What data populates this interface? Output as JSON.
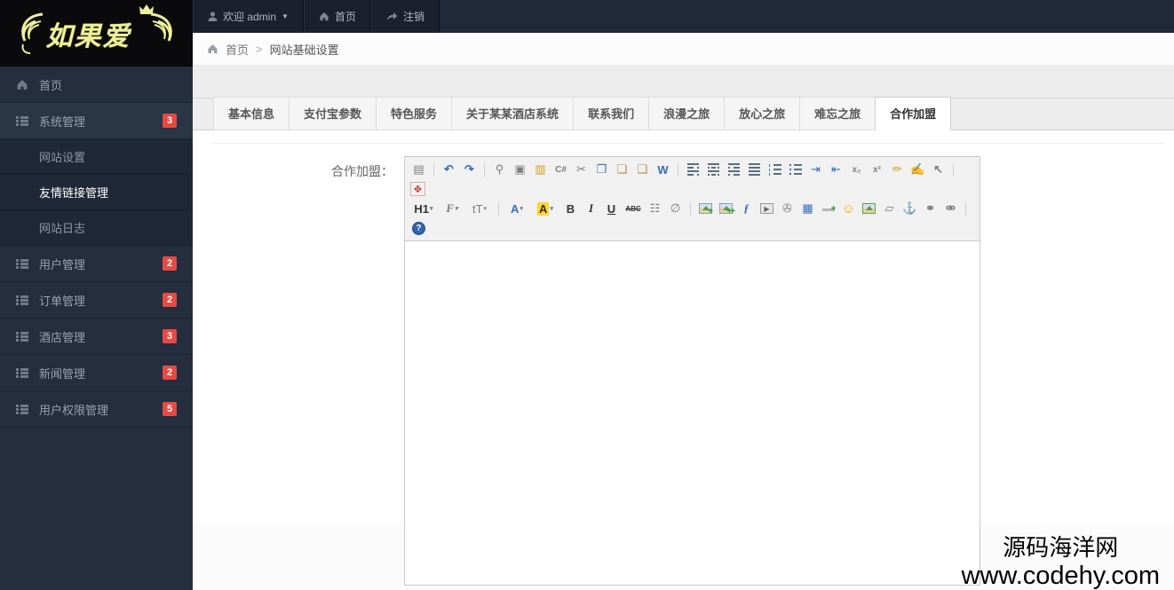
{
  "brand": {
    "name": "如果爱",
    "crown_icon": "crown",
    "wings_icon": "wings",
    "logo_color": "#eff09c"
  },
  "topbar": {
    "welcome": "欢迎 admin",
    "home": "首页",
    "logout": "注销"
  },
  "breadcrumb": {
    "home": "首页",
    "separator": ">",
    "current": "网站基础设置"
  },
  "sidebar": {
    "items": [
      {
        "label": "首页"
      },
      {
        "label": "系统管理",
        "badge": "3"
      },
      {
        "label": "网站设置"
      },
      {
        "label": "友情链接管理"
      },
      {
        "label": "网站日志"
      },
      {
        "label": "用户管理",
        "badge": "2"
      },
      {
        "label": "订单管理",
        "badge": "2"
      },
      {
        "label": "酒店管理",
        "badge": "3"
      },
      {
        "label": "新闻管理",
        "badge": "2"
      },
      {
        "label": "用户权限管理",
        "badge": "5"
      }
    ]
  },
  "tabs": [
    {
      "label": "基本信息"
    },
    {
      "label": "支付宝参数"
    },
    {
      "label": "特色服务"
    },
    {
      "label": "关于某某酒店系统"
    },
    {
      "label": "联系我们"
    },
    {
      "label": "浪漫之旅"
    },
    {
      "label": "放心之旅"
    },
    {
      "label": "难忘之旅"
    },
    {
      "label": "合作加盟",
      "active": true
    }
  ],
  "form": {
    "field_label": "合作加盟："
  },
  "icons": {
    "caret": "▼",
    "source": "▤",
    "undo": "↶",
    "redo": "↷",
    "preview": "⚲",
    "print": "▣",
    "selectall": "▥",
    "cleanhtml": "C#",
    "cut": "✂",
    "copy": "❐",
    "paste": "❏",
    "paste_text": "❑",
    "paste_word": "W",
    "indent": "⇥",
    "outdent": "⇤",
    "subscript": "x₂",
    "superscript": "x²",
    "format_brush": "✏",
    "quick_format": "✍",
    "pointer": "↖",
    "fullscreen": "✥",
    "heading": "H1",
    "font_family": "F",
    "font_size": "tT",
    "dropdown": "▾",
    "text_color": "A",
    "highlight_color": "A",
    "bold": "B",
    "italic": "I",
    "underline": "U",
    "strikethrough": "ABC",
    "line_height": "☷",
    "remove_format": "∅",
    "flash": "ƒ",
    "media": "▶",
    "attachment": "✇",
    "table": "▦",
    "emoticon": "☺",
    "pagebreak": "▱",
    "anchor": "⚓",
    "link": "⚭",
    "unlink": "⚮",
    "help": "?"
  },
  "toolbar_css_icons": [
    "align-left-icon",
    "align-center-icon",
    "align-right-icon",
    "align-justify-icon",
    "ordered-list-icon",
    "unordered-list-icon",
    "insert-image-icon",
    "multi-image-icon",
    "album-image-icon",
    "horizontal-rule-icon",
    "help-icon"
  ],
  "watermark": {
    "line1": "源码海洋网",
    "line2": "www.codehy.com"
  },
  "colors": {
    "badge_red": "#e74a42",
    "sidebar_bg": "#242e3e",
    "topbar_bg": "#1f2938",
    "toolbar_bg": "#f1f1f1",
    "logo_yellow": "#eff09c"
  }
}
